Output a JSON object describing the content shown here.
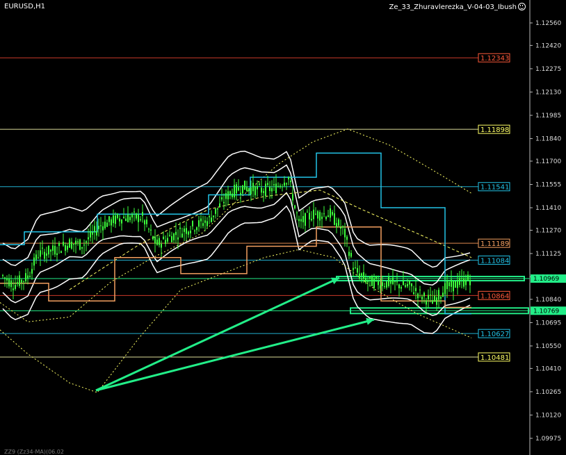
{
  "window": {
    "symbol_label": "EURUSD,H1",
    "indicator_name": "Ze_33_Zhuravlerezka_V-04-03_Ibush",
    "smiley_icon": "smiley-face-icon",
    "footer_text": "ZZ9 (Zz34-MA)(06.02"
  },
  "colors": {
    "background": "#000000",
    "candles": "#3cff3c",
    "white_band": "#ffffff",
    "yellow_dots": "#ffff66",
    "cyan": "#22c4e8",
    "orange": "#f4a060",
    "annotation_green": "#22ee88",
    "red_line": "#d04a2a"
  },
  "price_axis": {
    "ticks": [
      "1.12560",
      "1.12420",
      "1.12275",
      "1.12130",
      "1.11985",
      "1.11840",
      "1.11700",
      "1.11555",
      "1.11410",
      "1.11270",
      "1.11125",
      "1.10980",
      "1.10840",
      "1.10695",
      "1.10550",
      "1.10410",
      "1.10265",
      "1.10120",
      "1.09975"
    ]
  },
  "levels": [
    {
      "label": "1.12343",
      "price": 1.12343,
      "color": "#cc3a2a",
      "label_color": "#ff5a3a"
    },
    {
      "label": "1.11898",
      "price": 1.11898,
      "color": "#dcdc9a",
      "label_color": "#ffff66"
    },
    {
      "label": "1.11541",
      "price": 1.11541,
      "color": "#22b0d0",
      "label_color": "#22c4e8"
    },
    {
      "label": "1.11189",
      "price": 1.11189,
      "color": "#e08a50",
      "label_color": "#f4a060"
    },
    {
      "label": "1.11084",
      "price": 1.11084,
      "color": "#22b0d0",
      "label_color": "#22c4e8"
    },
    {
      "label": "1.10969",
      "price": 1.10969,
      "color": "#22ee88",
      "label_color": "#000000",
      "label_bg": "#22ee88",
      "current": true
    },
    {
      "label": "1.10864",
      "price": 1.10864,
      "color": "#cc3a2a",
      "label_color": "#ff5a3a"
    },
    {
      "label": "1.10769",
      "price": 1.10769,
      "color": "#22ee88",
      "label_color": "#000000",
      "label_bg": "#22ee88",
      "current": true
    },
    {
      "label": "1.10627",
      "price": 1.10627,
      "color": "#22b0d0",
      "label_color": "#22c4e8"
    },
    {
      "label": "1.10481",
      "price": 1.10481,
      "color": "#dcdc9a",
      "label_color": "#ffff66"
    }
  ]
}
